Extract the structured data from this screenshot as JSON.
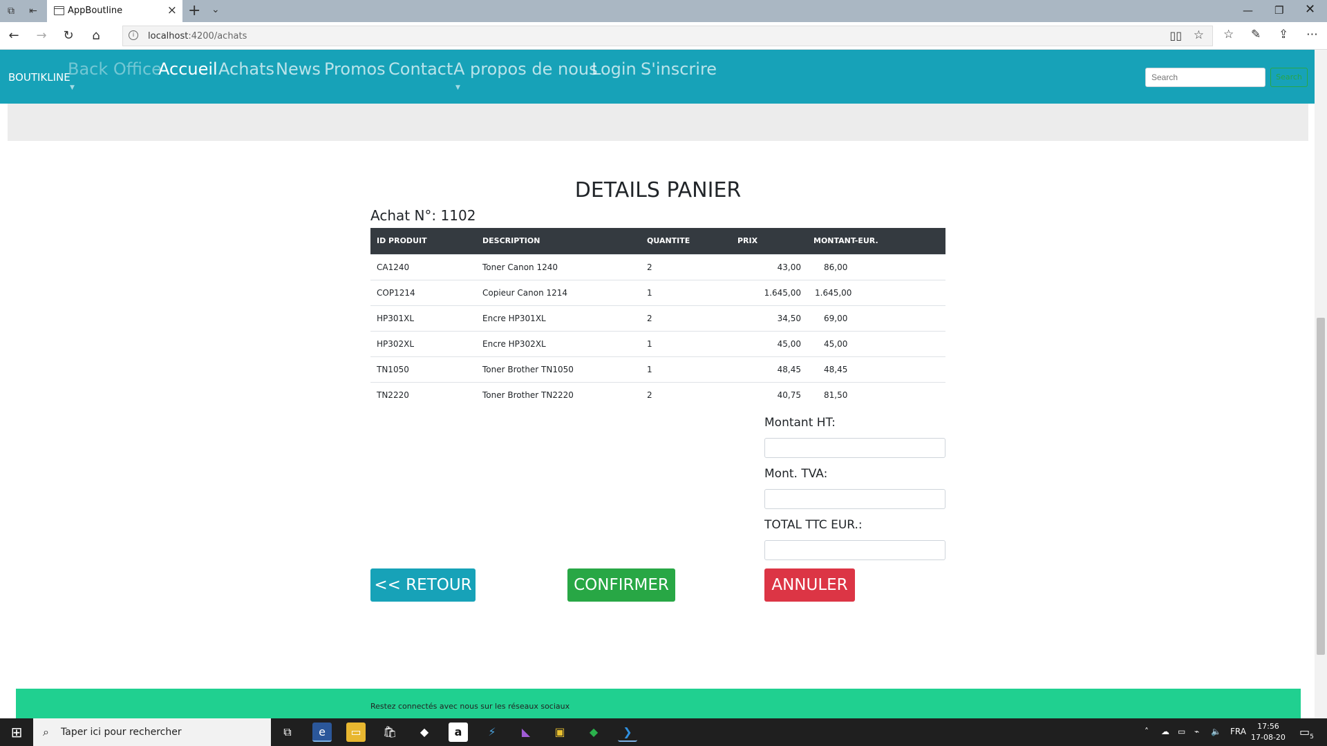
{
  "browser": {
    "tab_title": "AppBoutline",
    "url_host": "localhost",
    "url_rest": ":4200/achats"
  },
  "navbar": {
    "brand": "BOUTIKLINE",
    "links": [
      "Back Office",
      "Accueil",
      "Achats",
      "News",
      "Promos",
      "Contact",
      "A propos de nous",
      "Login",
      "S'inscrire"
    ],
    "search_placeholder": "Search",
    "search_button": "Search"
  },
  "page": {
    "title": "DETAILS PANIER",
    "achat_label": "Achat N°: 1102"
  },
  "table": {
    "headers": [
      "ID PRODUIT",
      "DESCRIPTION",
      "QUANTITE",
      "PRIX",
      "MONTANT-EUR."
    ],
    "rows": [
      [
        "CA1240",
        "Toner Canon 1240",
        "2",
        "43,00",
        "86,00"
      ],
      [
        "COP1214",
        "Copieur Canon 1214",
        "1",
        "1.645,00",
        "1.645,00"
      ],
      [
        "HP301XL",
        "Encre HP301XL",
        "2",
        "34,50",
        "69,00"
      ],
      [
        "HP302XL",
        "Encre HP302XL",
        "1",
        "45,00",
        "45,00"
      ],
      [
        "TN1050",
        "Toner Brother TN1050",
        "1",
        "48,45",
        "48,45"
      ],
      [
        "TN2220",
        "Toner Brother TN2220",
        "2",
        "40,75",
        "81,50"
      ]
    ]
  },
  "form": {
    "montant_ht_label": "Montant HT:",
    "montant_ht_value": "",
    "mont_tva_label": "Mont. TVA:",
    "mont_tva_value": "",
    "total_ttc_label": "TOTAL TTC EUR.:",
    "total_ttc_value": ""
  },
  "buttons": {
    "retour": "<< RETOUR",
    "confirmer": "CONFIRMER",
    "annuler": "ANNULER"
  },
  "footer": {
    "text": "Restez connectés avec nous sur les réseaux sociaux"
  },
  "taskbar": {
    "search_text": "Taper ici pour rechercher",
    "language": "FRA",
    "time": "17:56",
    "date": "17-08-20",
    "notifications": "5"
  },
  "colors": {
    "navbar": "#17a2b8",
    "table_header": "#343a40",
    "retour": "#17a2b8",
    "confirmer": "#28a745",
    "annuler": "#dc3545",
    "footer": "#20d090"
  }
}
